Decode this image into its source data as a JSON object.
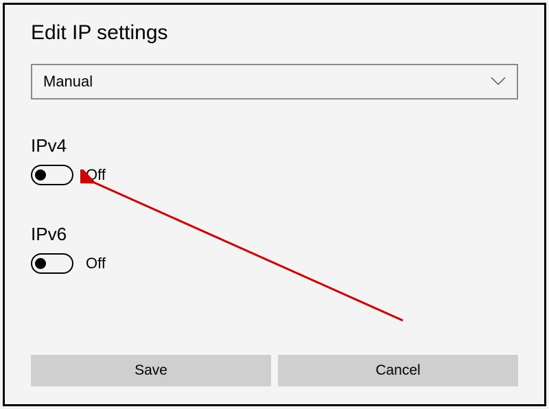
{
  "title": "Edit IP settings",
  "dropdown": {
    "selected": "Manual"
  },
  "ipv4": {
    "label": "IPv4",
    "state": "Off"
  },
  "ipv6": {
    "label": "IPv6",
    "state": "Off"
  },
  "buttons": {
    "save": "Save",
    "cancel": "Cancel"
  }
}
